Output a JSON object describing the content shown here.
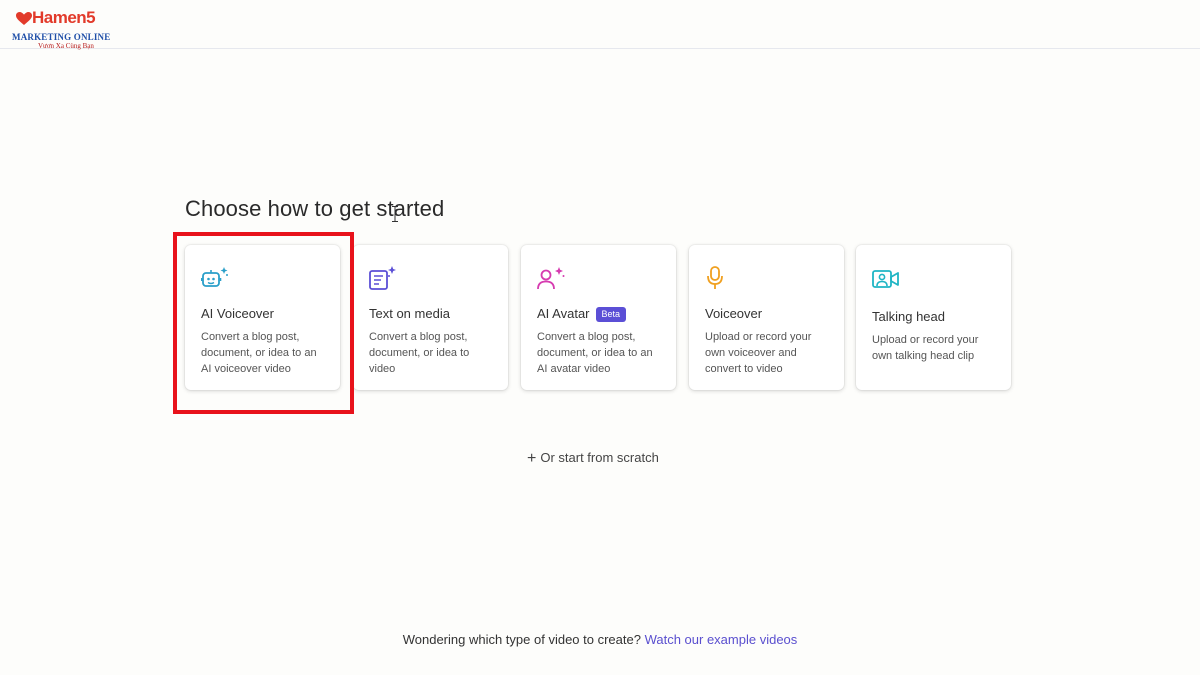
{
  "logo": {
    "brand": "Hamen5",
    "line2": "MARKETING ONLINE",
    "line3": "Vươn Xa Cùng Bạn",
    "colors": {
      "brand": "#e23a2a",
      "line2": "#1f4fa8",
      "line3": "#b71c1c"
    }
  },
  "heading": "Choose how to get started",
  "cards": [
    {
      "title": "AI Voiceover",
      "description": "Convert a blog post, document, or idea to an AI voiceover video",
      "icon": "ai-robot-icon",
      "icon_color": "#2a9fc9",
      "selected": true
    },
    {
      "title": "Text on media",
      "description": "Convert a blog post, document, or idea to video",
      "icon": "text-document-sparkle-icon",
      "icon_color": "#5b4fd6"
    },
    {
      "title": "AI Avatar",
      "badge": "Beta",
      "badge_color": "#5b4fd6",
      "description": "Convert a blog post, document, or idea to an AI avatar video",
      "icon": "person-sparkle-icon",
      "icon_color": "#d63bb0"
    },
    {
      "title": "Voiceover",
      "description": "Upload or record your own voiceover and convert to video",
      "icon": "microphone-icon",
      "icon_color": "#f0a020"
    },
    {
      "title": "Talking head",
      "description": "Upload or record your own talking head clip",
      "icon": "video-camera-person-icon",
      "icon_color": "#1fb5c4"
    }
  ],
  "highlight_color": "#e8121b",
  "scratch": {
    "label": "Or start from scratch",
    "icon": "plus-icon"
  },
  "footer": {
    "question": "Wondering which type of video to create?",
    "link": "Watch our example videos",
    "link_color": "#5a4fcf"
  }
}
